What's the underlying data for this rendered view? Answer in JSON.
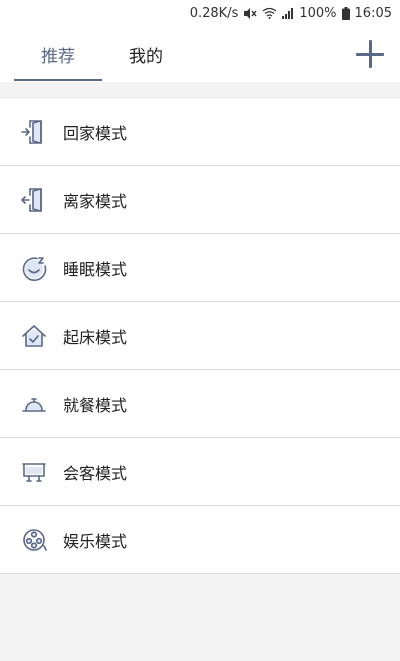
{
  "status_bar": {
    "speed": "0.28K/s",
    "battery": "100%",
    "time": "16:05"
  },
  "tabs": [
    {
      "label": "推荐",
      "active": true
    },
    {
      "label": "我的",
      "active": false
    }
  ],
  "add_button_icon": "plus-icon",
  "accent_color": "#5a6987",
  "modes": [
    {
      "label": "回家模式",
      "icon": "door-enter-icon"
    },
    {
      "label": "离家模式",
      "icon": "door-exit-icon"
    },
    {
      "label": "睡眠模式",
      "icon": "sleep-moon-icon"
    },
    {
      "label": "起床模式",
      "icon": "house-check-icon"
    },
    {
      "label": "就餐模式",
      "icon": "dining-bell-icon"
    },
    {
      "label": "会客模式",
      "icon": "reception-screen-icon"
    },
    {
      "label": "娱乐模式",
      "icon": "film-reel-icon"
    }
  ]
}
